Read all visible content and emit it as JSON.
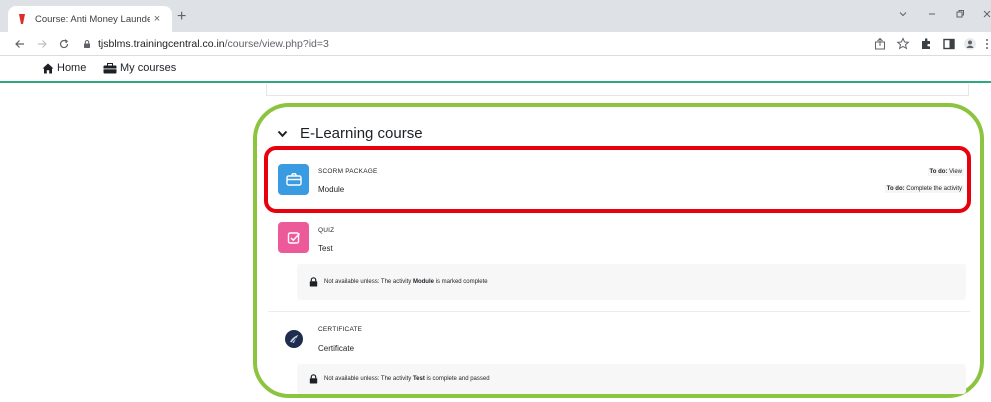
{
  "browser": {
    "tab_title": "Course: Anti Money Laundering",
    "tab_close": "×",
    "new_tab": "+",
    "url_host": "tjsblms.trainingcentral.co.in",
    "url_path": "/course/view.php?id=3"
  },
  "site_nav": {
    "home_label": "Home",
    "my_courses_label": "My courses"
  },
  "section": {
    "title": "E-Learning course"
  },
  "activities": [
    {
      "type": "SCORM PACKAGE",
      "name": "Module",
      "icon": "scorm-package-icon",
      "icon_color": "#399be2",
      "todos": [
        {
          "prefix": "To do:",
          "text": "View"
        },
        {
          "prefix": "To do:",
          "text": "Complete the activity"
        }
      ]
    },
    {
      "type": "QUIZ",
      "name": "Test",
      "icon": "quiz-icon",
      "icon_color": "#f7634d",
      "restriction": {
        "before": "Not available unless: The activity",
        "target": "Module",
        "after": "is marked complete"
      }
    },
    {
      "type": "CERTIFICATE",
      "name": "Certificate",
      "icon": "certificate-icon",
      "icon_color": "#1e2d4d",
      "restriction": {
        "before": "Not available unless: The activity",
        "target": "Test",
        "after": "is complete and passed"
      }
    }
  ],
  "colors": {
    "highlight_red": "#e8000d",
    "outline_green": "#8dc43f",
    "nav_underline": "#2ea87e",
    "quiz_pink": "#ec5a9a"
  }
}
